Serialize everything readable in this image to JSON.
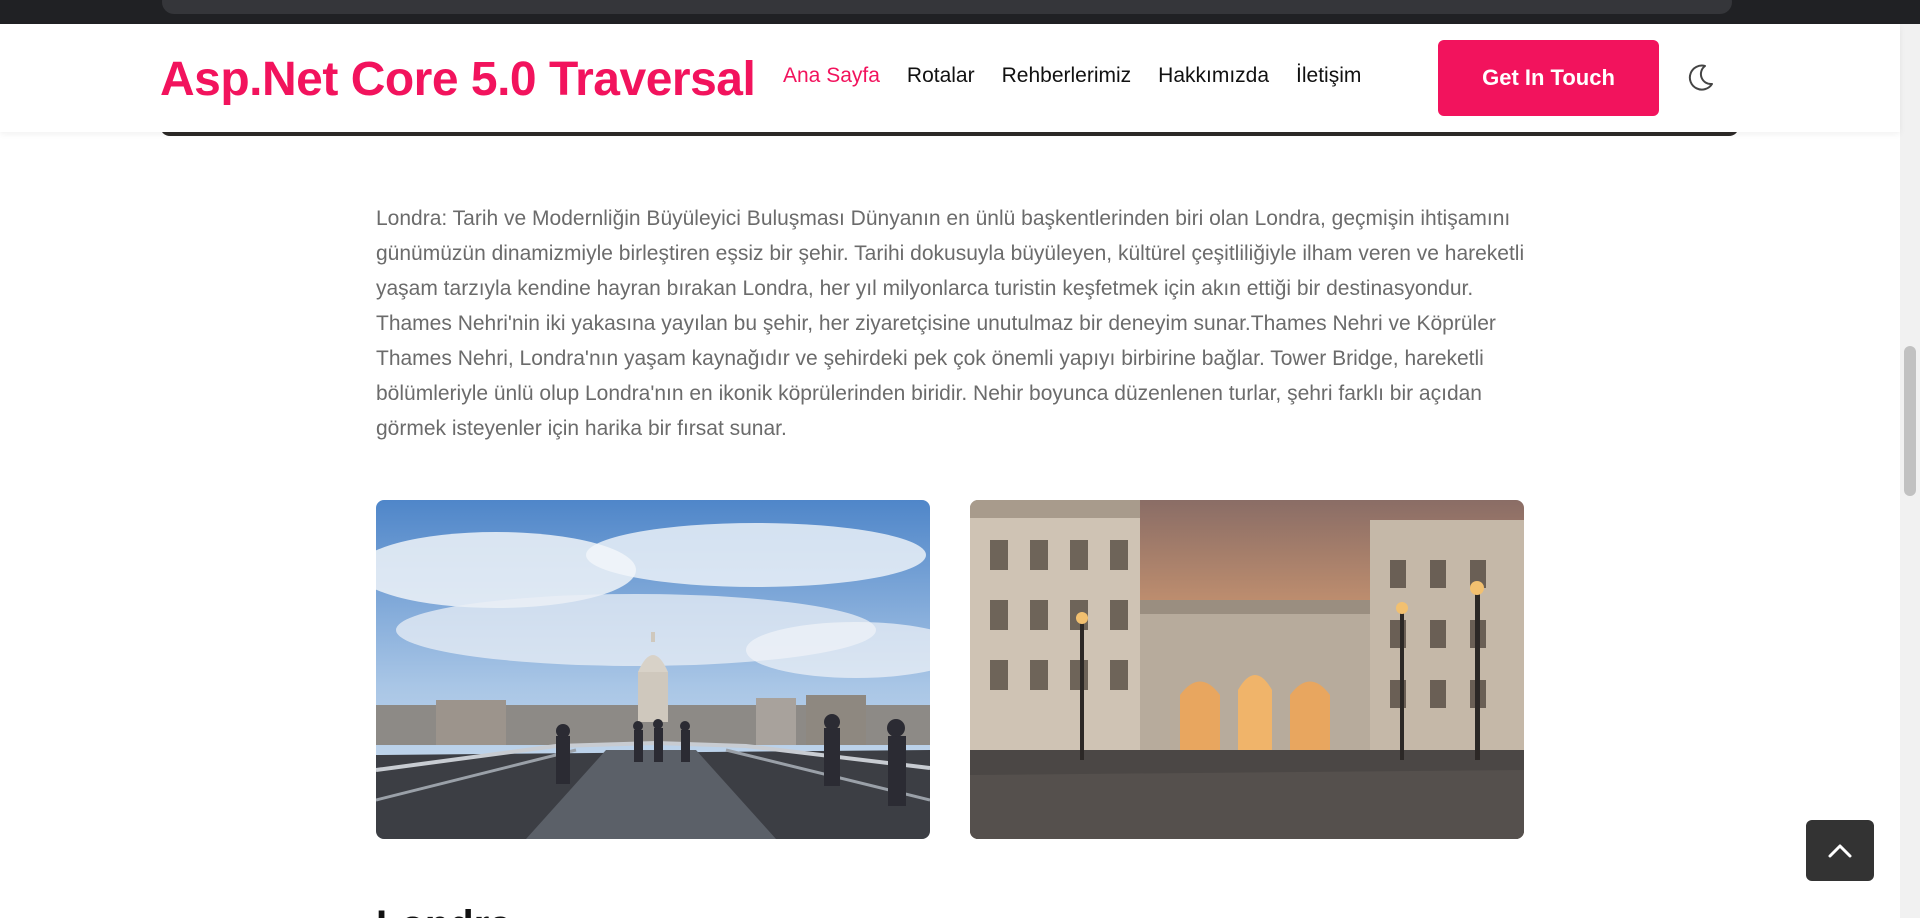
{
  "app": {
    "brand": "Asp.Net Core 5.0 Traversal",
    "accent_color": "#f2135d"
  },
  "nav": {
    "items": [
      {
        "label": "Ana Sayfa",
        "active": true
      },
      {
        "label": "Rotalar",
        "active": false
      },
      {
        "label": "Rehberlerimiz",
        "active": false
      },
      {
        "label": "Hakkımızda",
        "active": false
      },
      {
        "label": "İletişim",
        "active": false
      }
    ],
    "cta_label": "Get In Touch",
    "theme_toggle_icon": "moon-icon"
  },
  "content": {
    "intro": "Londra: Tarih ve Modernliğin Büyüleyici Buluşması Dünyanın en ünlü başkentlerinden biri olan Londra, geçmişin ihtişamını günümüzün dinamizmiyle birleştiren eşsiz bir şehir. Tarihi dokusuyla büyüleyen, kültürel çeşitliliğiyle ilham veren ve hareketli yaşam tarzıyla kendine hayran bırakan Londra, her yıl milyonlarca turistin keşfetmek için akın ettiği bir destinasyondur. Thames Nehri'nin iki yakasına yayılan bu şehir, her ziyaretçisine unutulmaz bir deneyim sunar.Thames Nehri ve Köprüler Thames Nehri, Londra'nın yaşam kaynağıdır ve şehirdeki pek çok önemli yapıyı birbirine bağlar. Tower Bridge, hareketli bölümleriyle ünlü olup Londra'nın en ikonik köprülerinden biridir. Nehir boyunca düzenlenen turlar, şehri farklı bir açıdan görmek isteyenler için harika bir fırsat sunar.",
    "next_heading_partial": "Londra"
  },
  "controls": {
    "back_to_top_icon": "chevron-up-icon"
  }
}
